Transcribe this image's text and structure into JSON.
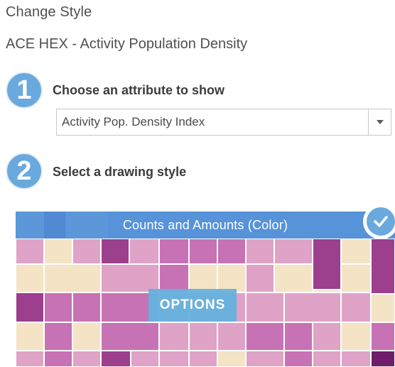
{
  "panel": {
    "title": "Change Style",
    "layer_name": "ACE HEX - Activity Population Density"
  },
  "step1": {
    "number": "1",
    "label": "Choose an attribute to show"
  },
  "attribute_select": {
    "value": "Activity Pop. Density Index",
    "icon": "chevron-down-icon"
  },
  "step2": {
    "number": "2",
    "label": "Select a drawing style"
  },
  "drawing_style": {
    "name": "Counts and Amounts (Color)",
    "options_label": "OPTIONS",
    "selected": true,
    "selected_icon": "checkmark-icon"
  },
  "colors": {
    "step_badge": "#6aa9dd",
    "banner": "#5d9dde",
    "options_button": "#65b1de",
    "map_palette": [
      "#f4e3c5",
      "#dfa3c8",
      "#c772b5",
      "#9c3f8d",
      "#6f1d6a"
    ]
  }
}
